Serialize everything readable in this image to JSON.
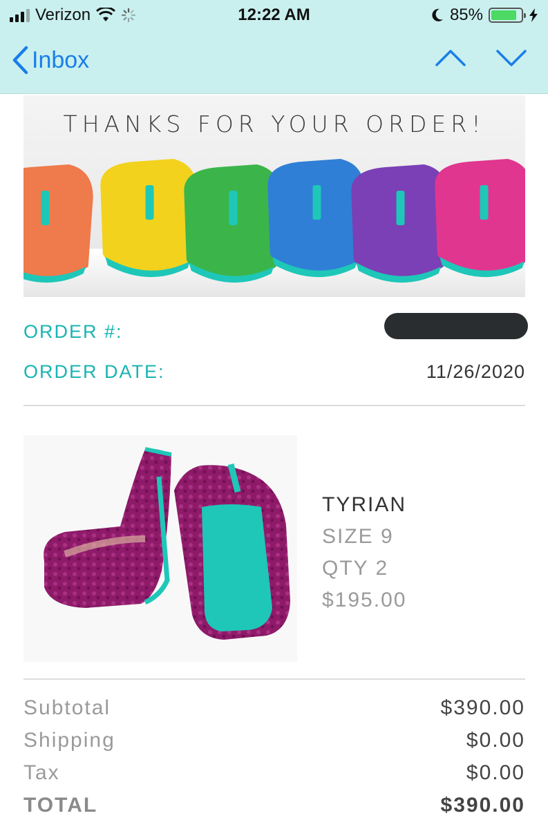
{
  "status_bar": {
    "carrier": "Verizon",
    "time": "12:22 AM",
    "battery_percent": "85%",
    "battery_level": 0.85,
    "icons": [
      "signal-icon",
      "wifi-icon",
      "activity-spinner-icon",
      "moon-icon",
      "battery-icon",
      "charging-bolt-icon"
    ]
  },
  "nav": {
    "back_label": "Inbox",
    "icons": [
      "chevron-left-icon",
      "chevron-up-icon",
      "chevron-down-icon"
    ]
  },
  "banner": {
    "title": "THANKS FOR YOUR ORDER!",
    "shoe_colors": [
      "#ef7a4b",
      "#f3d21e",
      "#3bb54a",
      "#2f7fd6",
      "#7b3fb6",
      "#e0368f"
    ],
    "sole_color": "#1ec7b8"
  },
  "order": {
    "number_label": "ORDER #:",
    "number_value": "",
    "date_label": "ORDER DATE:",
    "date_value": "11/26/2020"
  },
  "product": {
    "name": "TYRIAN",
    "size": "SIZE 9",
    "qty": "QTY 2",
    "price": "$195.00",
    "colors": {
      "velvet": "#8f1a6a",
      "sole": "#1ec7b8"
    }
  },
  "totals": {
    "subtotal_label": "Subtotal",
    "subtotal_value": "$390.00",
    "shipping_label": "Shipping",
    "shipping_value": "$0.00",
    "tax_label": "Tax",
    "tax_value": "$0.00",
    "total_label": "TOTAL",
    "total_value": "$390.00"
  },
  "colors": {
    "accent_teal": "#19b3b3",
    "ios_blue": "#1a7ee8",
    "chrome_bg": "#c9f0ef"
  }
}
